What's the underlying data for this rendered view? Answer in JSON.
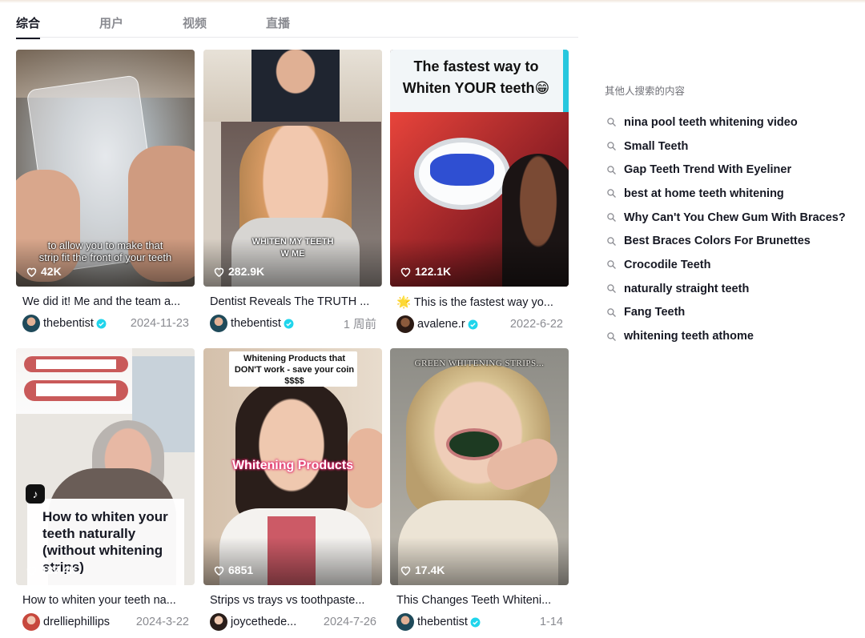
{
  "tabs": [
    "综合",
    "用户",
    "视频",
    "直播"
  ],
  "videos": [
    {
      "likes": "42K",
      "title": "We did it! Me and the team a...",
      "user": "thebentist",
      "verified": true,
      "date": "2024-11-23",
      "caption": "to allow you to make that strip fit the front of your teeth"
    },
    {
      "likes": "282.9K",
      "title": "Dentist Reveals The TRUTH ...",
      "user": "thebentist",
      "verified": true,
      "date": "1 周前",
      "caption": "WHITEN MY TEETH W ME"
    },
    {
      "likes": "122.1K",
      "title": "🌟 This is the fastest way yo...",
      "user": "avalene.r",
      "verified": true,
      "date": "2022-6-22",
      "caption": "The fastest way to Whiten YOUR teeth😁"
    },
    {
      "likes": "187.4K",
      "title": "How to whiten your teeth na...",
      "user": "drelliephillips",
      "verified": false,
      "date": "2024-3-22",
      "caption": "How to whiten your teeth naturally (without whitening strips)"
    },
    {
      "likes": "6851",
      "title": "Strips vs trays vs toothpaste...",
      "user": "joycethede...",
      "verified": false,
      "date": "2024-7-26",
      "caption": "Whitening Products that DON'T work - save your coin $$$$",
      "caption2": "Whitening Products"
    },
    {
      "likes": "17.4K",
      "title": "This Changes Teeth Whiteni...",
      "user": "thebentist",
      "verified": true,
      "date": "1-14",
      "caption": "GREEN WHITENING STRIPS..."
    }
  ],
  "sidebar": {
    "title": "其他人搜索的内容",
    "items": [
      "nina pool teeth whitening video",
      "Small Teeth",
      "Gap Teeth Trend With Eyeliner",
      "best at home teeth whitening",
      "Why Can't You Chew Gum With Braces?",
      "Best Braces Colors For Brunettes",
      "Crocodile Teeth",
      "naturally straight teeth",
      "Fang Teeth",
      "whitening teeth athome"
    ]
  },
  "colors": {
    "verified": "#20d5ec",
    "accent": "#fe2c55",
    "text": "#161823",
    "muted": "#8a8b91"
  },
  "icons": {
    "likes": "heart-outline-icon",
    "related": "search-icon",
    "verified": "verified-badge-icon"
  }
}
